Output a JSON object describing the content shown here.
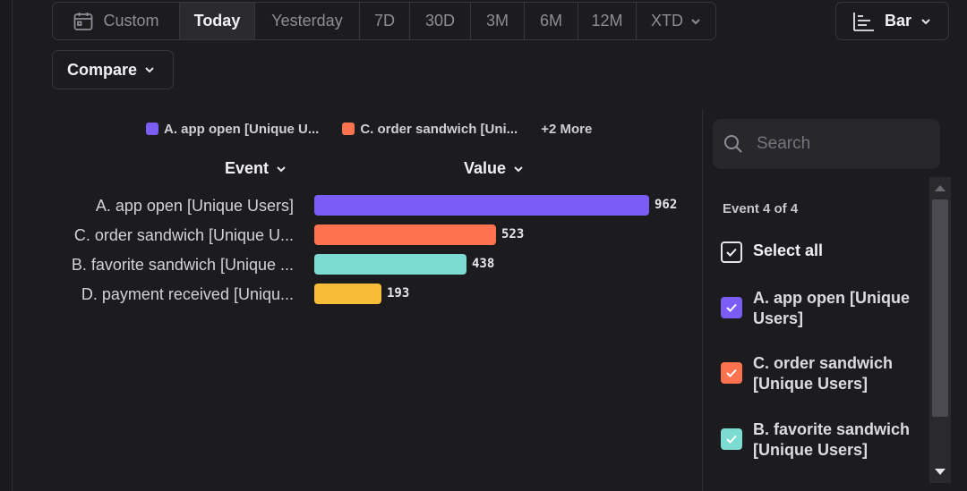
{
  "range": {
    "custom": "Custom",
    "today": "Today",
    "yesterday": "Yesterday",
    "d7": "7D",
    "d30": "30D",
    "m3": "3M",
    "m6": "6M",
    "m12": "12M",
    "xtd": "XTD",
    "selected": "Today"
  },
  "chart_type": {
    "label": "Bar",
    "icon": "bar-chart-icon"
  },
  "compare": {
    "label": "Compare"
  },
  "legend": {
    "items": [
      {
        "label": "A. app open [Unique U...",
        "color": "#7c5cf6"
      },
      {
        "label": "C. order sandwich [Uni...",
        "color": "#ff7250"
      }
    ],
    "more": "+2 More"
  },
  "columns": {
    "event": "Event",
    "value": "Value"
  },
  "chart_data": {
    "type": "bar",
    "orientation": "horizontal",
    "categories": [
      "A. app open [Unique Users]",
      "C. order sandwich [Unique U...",
      "B. favorite sandwich [Unique ...",
      "D. payment received [Uniqu..."
    ],
    "values": [
      962,
      523,
      438,
      193
    ],
    "colors": [
      "#7c5cf6",
      "#ff7250",
      "#7ddcd2",
      "#f8bd38"
    ]
  },
  "panel": {
    "search_placeholder": "Search",
    "count_label": "Event 4 of 4",
    "select_all": "Select all",
    "options": [
      {
        "line1": "A. app open [Unique",
        "line2": "Users]",
        "color": "#7c5cf6"
      },
      {
        "line1": "C. order sandwich",
        "line2": "[Unique Users]",
        "color": "#ff7250"
      },
      {
        "line1": "B. favorite sandwich",
        "line2": "[Unique Users]",
        "color": "#7ddcd2"
      }
    ]
  }
}
